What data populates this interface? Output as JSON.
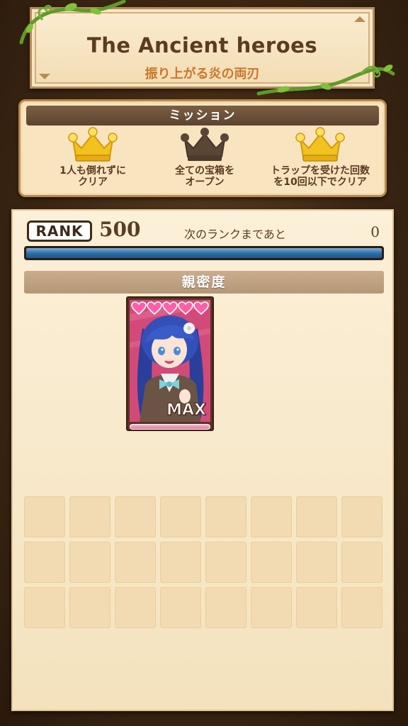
{
  "quest": {
    "title": "The Ancient heroes",
    "subtitle": "振り上がる炎の両刃"
  },
  "missions": {
    "header": "ミッション",
    "items": [
      {
        "text": "1人も倒れずに\nクリア",
        "achieved": true
      },
      {
        "text": "全ての宝箱を\nオープン",
        "achieved": false
      },
      {
        "text": "トラップを受けた回数\nを10回以下でクリア",
        "achieved": true
      }
    ]
  },
  "rank": {
    "badge": "RANK",
    "value": "500",
    "next_label": "次のランクまであと",
    "next_value": "0",
    "progress": 1.0
  },
  "affection": {
    "header": "親密度",
    "card": {
      "hearts": 5,
      "max_label": "MAX",
      "gauge": 1.0
    }
  },
  "slots": {
    "rows": 3,
    "cols": 8,
    "filled": 0
  },
  "colors": {
    "gold_crown": "#f2c21e",
    "dark_crown": "#5a4536",
    "accent_orange": "#c9772a",
    "progress_blue": "#2e6fa8",
    "heart_pink": "#ff5fa8"
  }
}
